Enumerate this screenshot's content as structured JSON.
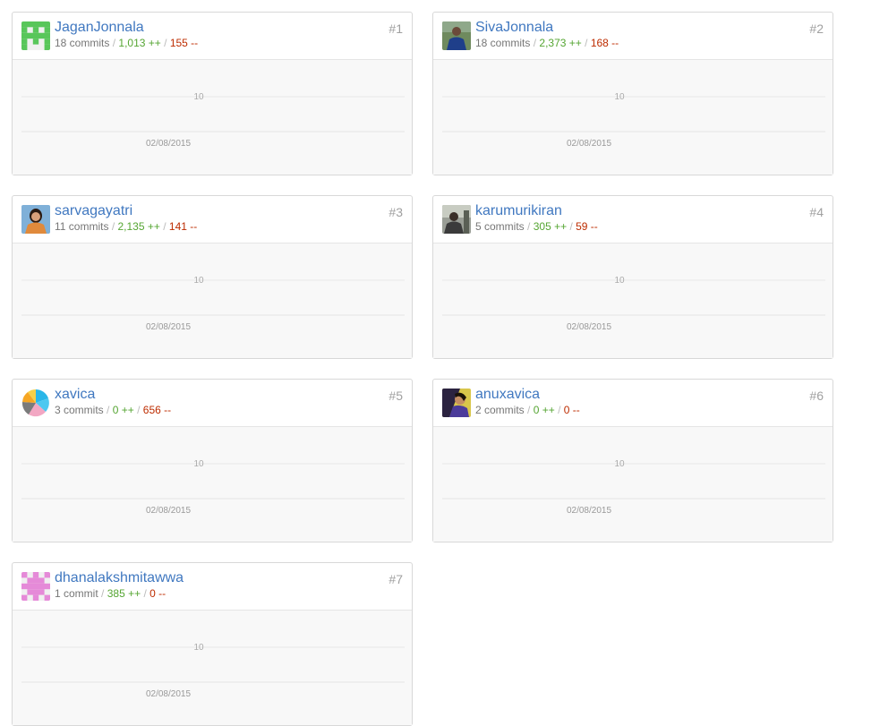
{
  "contributors": [
    {
      "rank": "#1",
      "name": "JaganJonnala",
      "commits": "18 commits",
      "additions": "1,013 ++",
      "deletions": "155 --",
      "avatar": "identicon-green-icon",
      "y_tick": "10",
      "x_tick": "02/08/2015"
    },
    {
      "rank": "#2",
      "name": "SivaJonnala",
      "commits": "18 commits",
      "additions": "2,373 ++",
      "deletions": "168 --",
      "avatar": "user-photo-icon",
      "y_tick": "10",
      "x_tick": "02/08/2015"
    },
    {
      "rank": "#3",
      "name": "sarvagayatri",
      "commits": "11 commits",
      "additions": "2,135 ++",
      "deletions": "141 --",
      "avatar": "user-photo-icon",
      "y_tick": "10",
      "x_tick": "02/08/2015"
    },
    {
      "rank": "#4",
      "name": "karumurikiran",
      "commits": "5 commits",
      "additions": "305 ++",
      "deletions": "59 --",
      "avatar": "user-photo-icon",
      "y_tick": "10",
      "x_tick": "02/08/2015"
    },
    {
      "rank": "#5",
      "name": "xavica",
      "commits": "3 commits",
      "additions": "0 ++",
      "deletions": "656 --",
      "avatar": "pie-logo-icon",
      "y_tick": "10",
      "x_tick": "02/08/2015"
    },
    {
      "rank": "#6",
      "name": "anuxavica",
      "commits": "2 commits",
      "additions": "0 ++",
      "deletions": "0 --",
      "avatar": "user-photo-icon",
      "y_tick": "10",
      "x_tick": "02/08/2015"
    },
    {
      "rank": "#7",
      "name": "dhanalakshmitawwa",
      "commits": "1 commit",
      "additions": "385 ++",
      "deletions": "0 --",
      "avatar": "identicon-pink-icon",
      "y_tick": "10",
      "x_tick": "02/08/2015"
    }
  ],
  "separator": "/",
  "colors": {
    "link": "#4078c0",
    "additions": "#55a532",
    "deletions": "#bd2c00",
    "chart_bg": "#f8f8f8"
  }
}
